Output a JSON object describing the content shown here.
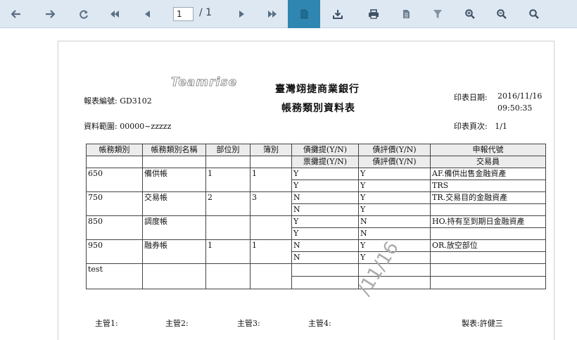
{
  "toolbar": {
    "page_current": "1",
    "page_total": "/ 1",
    "icons": [
      "back-arrow-icon",
      "forward-arrow-icon",
      "refresh-icon",
      "first-page-icon",
      "prev-page-icon",
      "next-page-icon",
      "last-page-icon",
      "document-icon",
      "download-icon",
      "print-icon",
      "file-icon",
      "filter-icon",
      "zoom-in-icon",
      "zoom-out-icon",
      "zoom-reset-icon"
    ],
    "accent_color": "#2f86b0",
    "bar_color": "#dde8f3"
  },
  "report": {
    "logo_text": "Teamrise",
    "bank_name": "臺灣翊捷商業銀行",
    "title": "帳務類別資料表",
    "code_label": "報表編號: GD3102",
    "range_label": "資料範圍: 00000~zzzzz",
    "date_label": "印表日期:",
    "date_value": "2016/11/16",
    "time_value": "09:50:35",
    "page_label": "印表頁次:",
    "page_value": "1/1",
    "headers": [
      "帳務類別",
      "帳務類別名稱",
      "部位別",
      "簿別",
      "債攤提(Y/N)",
      "債評價(Y/N)",
      "申報代號"
    ],
    "sub_headers": [
      "票攤提(Y/N)",
      "債評價(Y/N)",
      "交易員"
    ],
    "rows": [
      {
        "code": "650",
        "name": "備供帳",
        "pos": "1",
        "book": "1",
        "r1": [
          "Y",
          "Y",
          "AF.備供出售金融資產"
        ],
        "r2": [
          "Y",
          "Y",
          "TRS"
        ]
      },
      {
        "code": "750",
        "name": "交易帳",
        "pos": "2",
        "book": "3",
        "r1": [
          "N",
          "Y",
          "TR.交易目的金融資產"
        ],
        "r2": [
          "N",
          "Y",
          ""
        ]
      },
      {
        "code": "850",
        "name": "調度帳",
        "pos": "",
        "book": "",
        "r1": [
          "Y",
          "N",
          "HO.持有至到期日金融資產"
        ],
        "r2": [
          "Y",
          "N",
          ""
        ]
      },
      {
        "code": "950",
        "name": "融券帳",
        "pos": "1",
        "book": "1",
        "r1": [
          "N",
          "Y",
          "OR.放空部位"
        ],
        "r2": [
          "N",
          "Y",
          ""
        ]
      },
      {
        "code": "test",
        "name": "",
        "pos": "",
        "book": "",
        "r1": [
          "",
          "",
          ""
        ],
        "r2": [
          "",
          "",
          ""
        ]
      }
    ],
    "watermark": "/11/16",
    "signatures": [
      "主管1:",
      "主管2:",
      "主管3:",
      "主管4:",
      "製表:許健三"
    ]
  }
}
